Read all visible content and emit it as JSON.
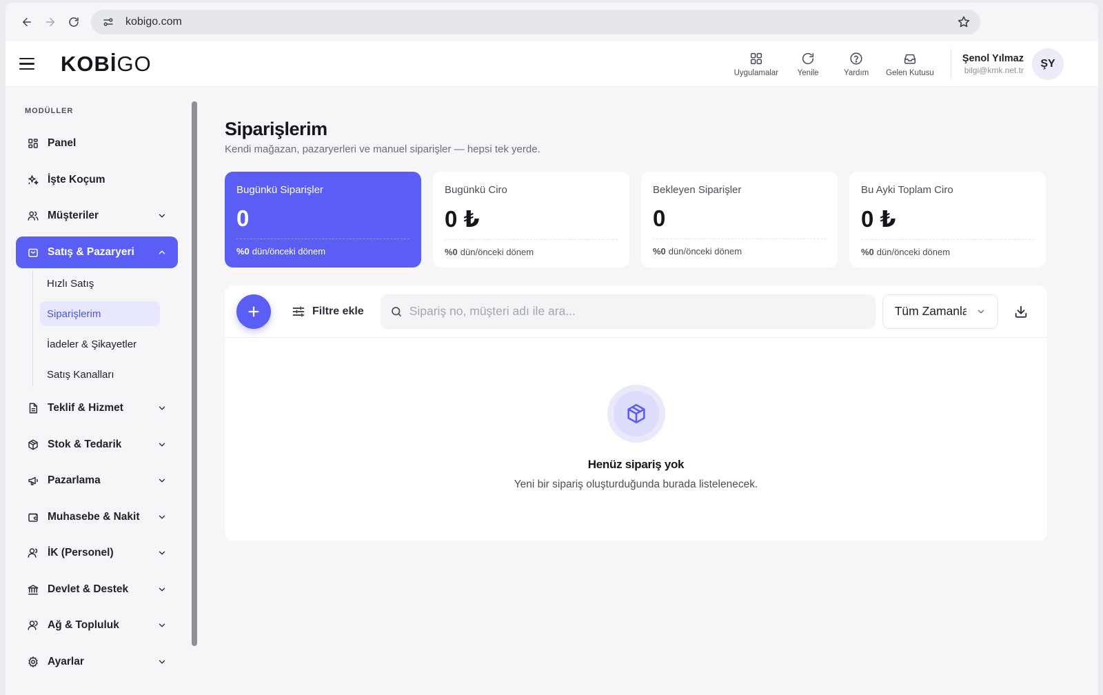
{
  "browser": {
    "url": "kobigo.com"
  },
  "header": {
    "logo_bold": "KOBİ",
    "logo_light": "GO",
    "actions": [
      {
        "label": "Uygulamalar",
        "icon": "grid-icon"
      },
      {
        "label": "Yenile",
        "icon": "refresh-icon"
      },
      {
        "label": "Yardım",
        "icon": "help-icon"
      },
      {
        "label": "Gelen Kutusu",
        "icon": "inbox-icon"
      }
    ],
    "user": {
      "name": "Şenol Yılmaz",
      "email": "bilgi@kmk.net.tr",
      "initials": "ŞY"
    }
  },
  "sidebar": {
    "section_title": "MODÜLLER",
    "items": [
      {
        "label": "Panel",
        "icon": "dashboard-icon"
      },
      {
        "label": "İşte Koçum",
        "icon": "sparkles-icon"
      },
      {
        "label": "Müşteriler",
        "icon": "users-icon"
      },
      {
        "label": "Satış & Pazaryeri",
        "icon": "shopping-bag-icon",
        "active": true
      },
      {
        "label": "Teklif & Hizmet",
        "icon": "document-icon"
      },
      {
        "label": "Stok & Tedarik",
        "icon": "box-icon"
      },
      {
        "label": "Pazarlama",
        "icon": "megaphone-icon"
      },
      {
        "label": "Muhasebe & Nakit",
        "icon": "wallet-icon"
      },
      {
        "label": "İK (Personel)",
        "icon": "person-icon"
      },
      {
        "label": "Devlet & Destek",
        "icon": "bank-icon"
      },
      {
        "label": "Ağ & Topluluk",
        "icon": "network-icon"
      },
      {
        "label": "Ayarlar",
        "icon": "gear-icon"
      }
    ],
    "sub_items": [
      {
        "label": "Hızlı Satış"
      },
      {
        "label": "Siparişlerim",
        "active": true
      },
      {
        "label": "İadeler & Şikayetler"
      },
      {
        "label": "Satış Kanalları"
      }
    ]
  },
  "main": {
    "title": "Siparişlerim",
    "subtitle": "Kendi mağazan, pazaryerleri ve manuel siparişler — hepsi tek yerde.",
    "cards": [
      {
        "label": "Bugünkü Siparişler",
        "value": "0",
        "change": "%0",
        "period": "dün/önceki dönem"
      },
      {
        "label": "Bugünkü Ciro",
        "value": "0 ₺",
        "change": "%0",
        "period": "dün/önceki dönem"
      },
      {
        "label": "Bekleyen Siparişler",
        "value": "0",
        "change": "%0",
        "period": "dün/önceki dönem"
      },
      {
        "label": "Bu Ayki Toplam Ciro",
        "value": "0 ₺",
        "change": "%0",
        "period": "dün/önceki dönem"
      }
    ],
    "toolbar": {
      "filter_label": "Filtre ekle",
      "search_placeholder": "Sipariş no, müşteri adı ile ara...",
      "search_value": "",
      "period_selected": "Tüm Zamanlar"
    },
    "empty_state": {
      "title": "Henüz sipariş yok",
      "text": "Yeni bir sipariş oluşturduğunda burada listelenecek."
    }
  },
  "colors": {
    "accent": "#5b5ef5",
    "accent_soft": "#e7e7fd"
  }
}
